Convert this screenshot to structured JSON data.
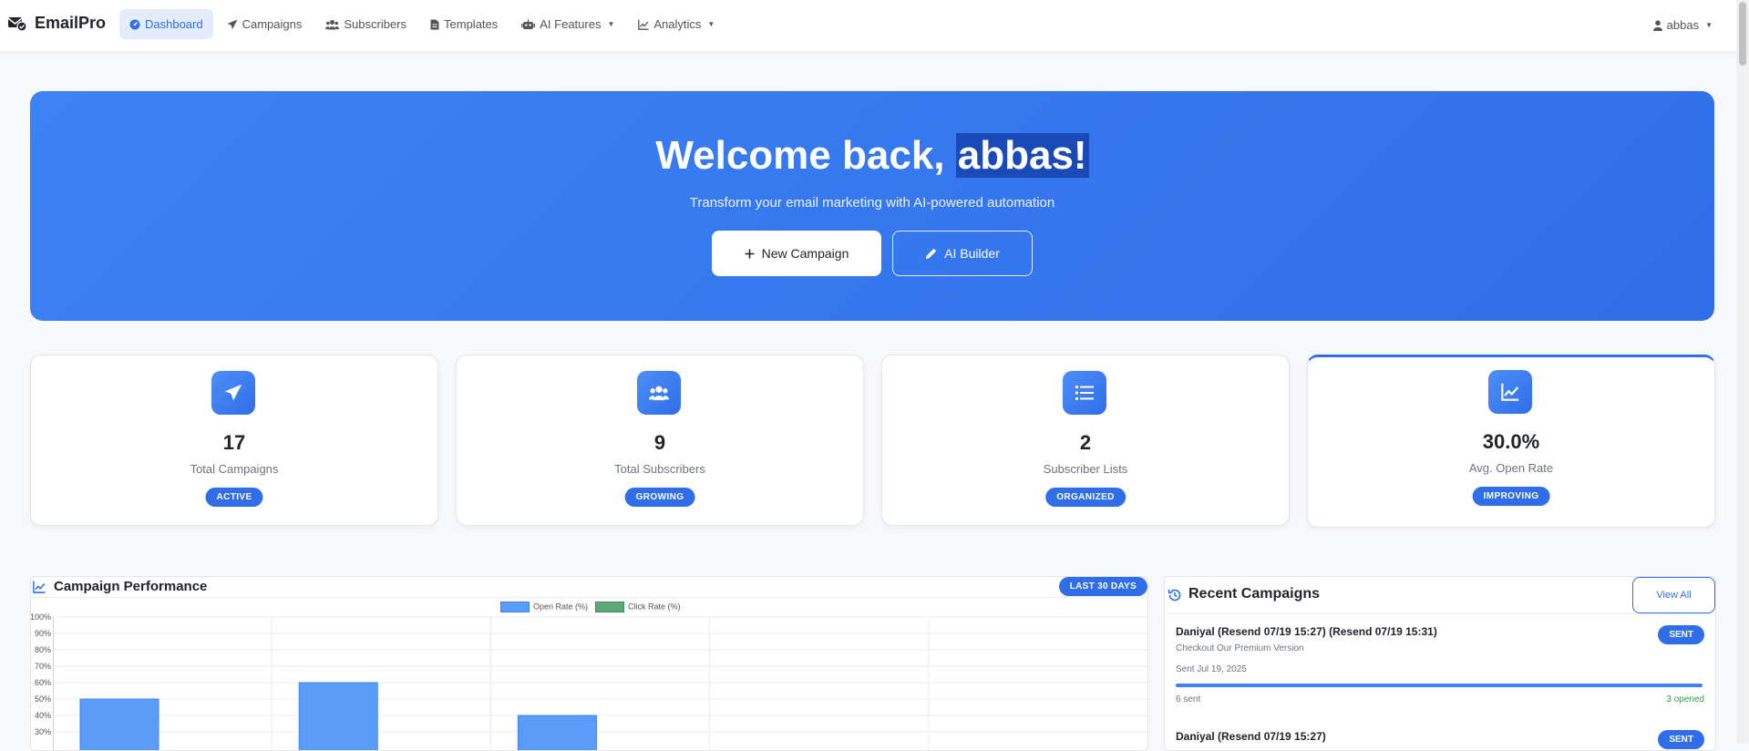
{
  "brand": {
    "name": "EmailPro"
  },
  "nav": [
    {
      "label": "Dashboard",
      "icon": "dashboard-icon",
      "active": true
    },
    {
      "label": "Campaigns",
      "icon": "paper-plane-icon"
    },
    {
      "label": "Subscribers",
      "icon": "users-icon"
    },
    {
      "label": "Templates",
      "icon": "file-icon"
    },
    {
      "label": "AI Features",
      "icon": "robot-icon",
      "dropdown": true
    },
    {
      "label": "Analytics",
      "icon": "chart-line-icon",
      "dropdown": true
    }
  ],
  "user": {
    "name": "abbas"
  },
  "hero": {
    "welcome": "Welcome back,",
    "name": "abbas!",
    "subtitle": "Transform your email marketing with AI-powered automation",
    "new_campaign": "New Campaign",
    "ai_builder": "AI Builder"
  },
  "stats": [
    {
      "value": "17",
      "label": "Total Campaigns",
      "badge": "ACTIVE",
      "icon": "paper-plane-icon"
    },
    {
      "value": "9",
      "label": "Total Subscribers",
      "badge": "GROWING",
      "icon": "users-icon"
    },
    {
      "value": "2",
      "label": "Subscriber Lists",
      "badge": "ORGANIZED",
      "icon": "list-icon"
    },
    {
      "value": "30.0%",
      "label": "Avg. Open Rate",
      "badge": "IMPROVING",
      "icon": "chart-line-icon"
    }
  ],
  "performance": {
    "title": "Campaign Performance",
    "badge": "LAST 30 DAYS",
    "colors": {
      "open": "#5b9cf8",
      "click": "#5fa877"
    }
  },
  "chart_data": {
    "type": "bar",
    "title": "Campaign Performance",
    "series": [
      {
        "name": "Open Rate (%)",
        "values": [
          50,
          60,
          40,
          null,
          null
        ]
      },
      {
        "name": "Click Rate (%)",
        "values": [
          0,
          0,
          0,
          null,
          null
        ]
      }
    ],
    "y_ticks": [
      "100%",
      "90%",
      "80%",
      "70%",
      "60%",
      "50%",
      "40%",
      "30%"
    ],
    "ylim": [
      0,
      100
    ],
    "grid": true,
    "legend_position": "top"
  },
  "recent": {
    "title": "Recent Campaigns",
    "view_all": "View All",
    "items": [
      {
        "name": "Daniyal (Resend 07/19 15:27) (Resend 07/19 15:31)",
        "subject": "Checkout Our Premium Version",
        "date": "Sent Jul 19, 2025",
        "status": "SENT",
        "sent": "6 sent",
        "opened": "3 opened",
        "progress": 1.0
      },
      {
        "name": "Daniyal (Resend 07/19 15:27)",
        "status": "SENT"
      }
    ]
  }
}
